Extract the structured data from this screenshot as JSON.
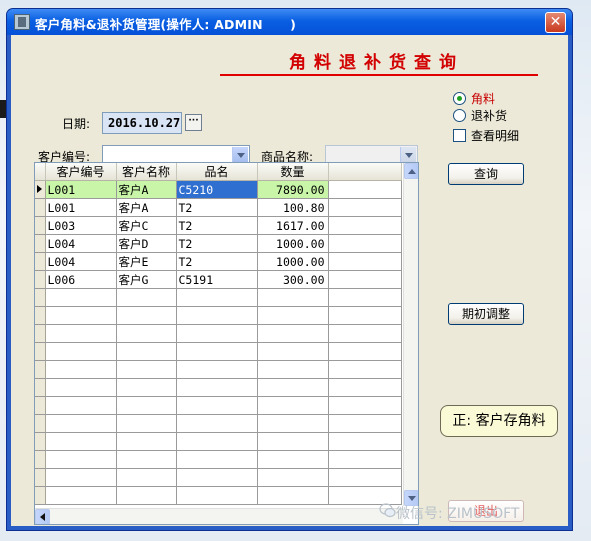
{
  "window": {
    "title": "客户角料&退补货管理(操作人: ADMIN      )",
    "close_symbol": "✕"
  },
  "header": {
    "title": "角料退补货查询",
    "accent_color": "#e10000"
  },
  "filters": {
    "date_label": "日期:",
    "date_value": "2016.10.27",
    "date_button": "···",
    "customer_code_label": "客户编号:",
    "customer_code_value": "",
    "product_name_label": "商品名称:",
    "product_name_value": ""
  },
  "options": {
    "mode_scrap_label": "角料",
    "mode_return_label": "退补货",
    "mode_selected": "角料",
    "show_detail_label": "查看明细",
    "show_detail_checked": false
  },
  "grid": {
    "columns": [
      "客户编号",
      "客户名称",
      "品名",
      "数量"
    ],
    "rows": [
      [
        "L001",
        "客户A",
        "C5210",
        "7890.00"
      ],
      [
        "L001",
        "客户A",
        "T2",
        "100.80"
      ],
      [
        "L003",
        "客户C",
        "T2",
        "1617.00"
      ],
      [
        "L004",
        "客户D",
        "T2",
        "1000.00"
      ],
      [
        "L004",
        "客户E",
        "T2",
        "1000.00"
      ],
      [
        "L006",
        "客户G",
        "C5191",
        "300.00"
      ]
    ],
    "selected_row": 0,
    "selection_color": "#2f6fd0",
    "row_highlight_color": "#c8f5a8"
  },
  "buttons": {
    "query": "查询",
    "initial_adjust": "期初调整",
    "exit": "退出"
  },
  "tip": {
    "text": "正: 客户存角料"
  },
  "watermark": {
    "text": "微信号: ZIMUSOFT"
  }
}
